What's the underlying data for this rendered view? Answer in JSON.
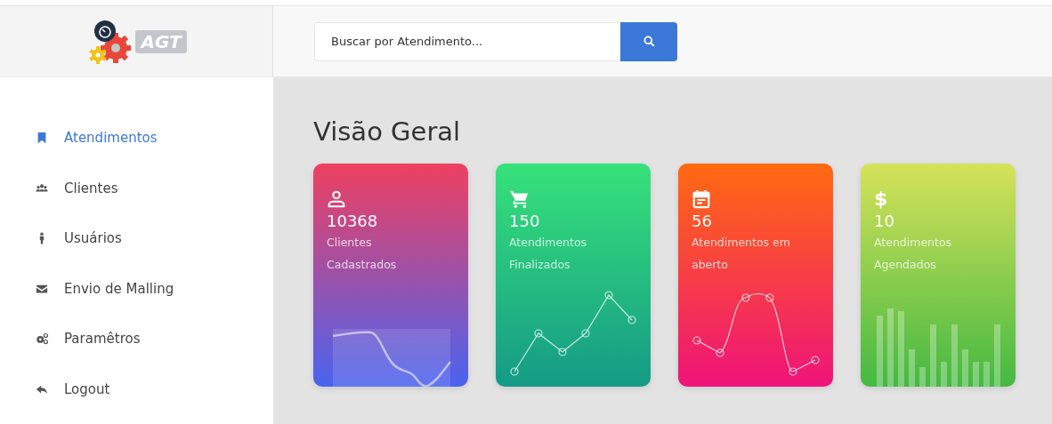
{
  "logo": {
    "text": "AGT"
  },
  "search": {
    "placeholder": "Buscar por Atendimento..."
  },
  "sidebar": {
    "items": [
      {
        "label": "Atendimentos",
        "selected": true
      },
      {
        "label": "Clientes",
        "selected": false
      },
      {
        "label": "Usuários",
        "selected": false
      },
      {
        "label": "Envio de Malling",
        "selected": false
      },
      {
        "label": "Paramêtros",
        "selected": false
      },
      {
        "label": "Logout",
        "selected": false
      }
    ]
  },
  "page_title": "Visão Geral",
  "cards": [
    {
      "value": "10368",
      "caption": [
        "Clientes",
        "Cadastrados"
      ],
      "color": "#ef4060"
    },
    {
      "value": "150",
      "caption": [
        "Atendimentos",
        "Finalizados"
      ],
      "color": "#36e27a"
    },
    {
      "value": "56",
      "caption": [
        "Atendimentos em",
        "aberto"
      ],
      "color": "#ff6a10"
    },
    {
      "symbol": "$",
      "value": "10",
      "caption": [
        "Atendimentos",
        "Agendados"
      ],
      "color": "#d6e25a"
    }
  ]
}
